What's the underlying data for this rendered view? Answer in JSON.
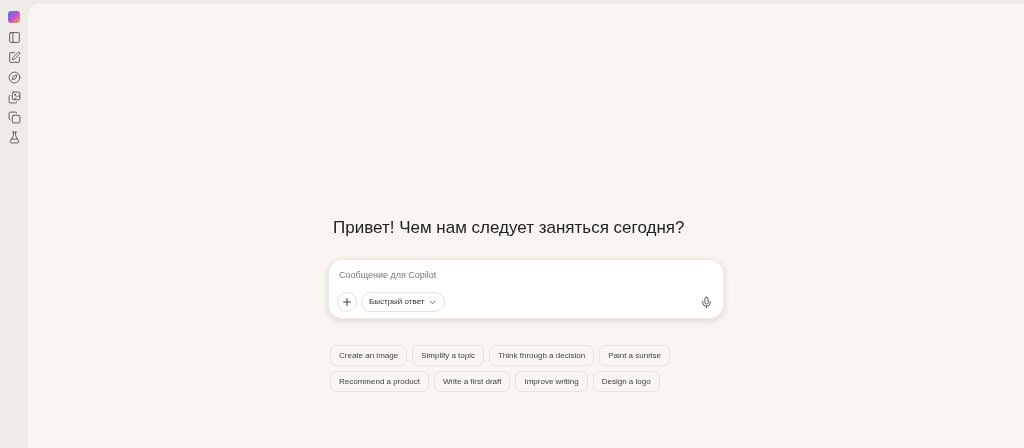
{
  "greeting": "Привет! Чем нам следует заняться сегодня?",
  "composer": {
    "placeholder": "Сообщение для Copilot",
    "mode": "Быстрый ответ"
  },
  "suggestions": [
    [
      "Create an image",
      "Simplify a topic",
      "Think through a decision",
      "Paint a sunrise"
    ],
    [
      "Recommend a product",
      "Write a first draft",
      "Improve writing",
      "Design a logo"
    ]
  ]
}
